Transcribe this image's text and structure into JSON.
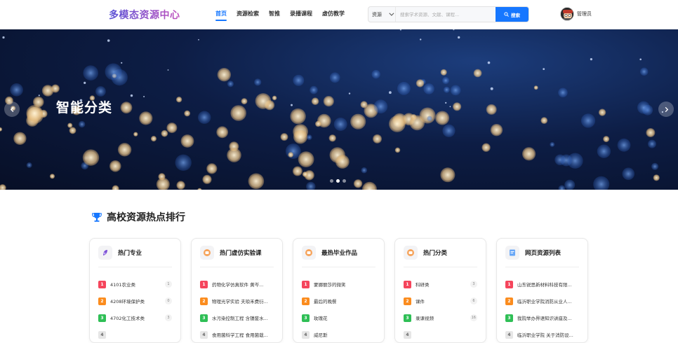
{
  "header": {
    "logo": "多模态资源中心",
    "nav": [
      {
        "label": "首页",
        "active": true
      },
      {
        "label": "资源检索",
        "active": false
      },
      {
        "label": "智推",
        "active": false
      },
      {
        "label": "录播课程",
        "active": false
      },
      {
        "label": "虚仿教学",
        "active": false
      }
    ],
    "search": {
      "type": "资源",
      "placeholder": "搜索学术资源、文献、课程...",
      "button": "搜索"
    },
    "user": {
      "name": "管理员"
    }
  },
  "banner": {
    "title": "智能分类",
    "slides": 3,
    "active_slide": 1
  },
  "section": {
    "title": "高校资源热点排行"
  },
  "cards": [
    {
      "title": "热门专业",
      "icon": "major-icon",
      "items": [
        {
          "rank": "1",
          "text": "4101农业类",
          "count": "1"
        },
        {
          "rank": "2",
          "text": "4208环境保护类",
          "count": "0"
        },
        {
          "rank": "3",
          "text": "4702化工技术类",
          "count": "3"
        },
        {
          "rank": "4",
          "text": "",
          "count": ""
        }
      ]
    },
    {
      "title": "热门虚仿实验课",
      "icon": "experiment-icon",
      "items": [
        {
          "rank": "1",
          "text": "药物化学仿真软件 黄岑...",
          "count": ""
        },
        {
          "rank": "2",
          "text": "物理光学实验 夫琅禾费衍...",
          "count": ""
        },
        {
          "rank": "3",
          "text": "水污染控制工程 含镍废水...",
          "count": ""
        },
        {
          "rank": "4",
          "text": "食用菌科学工程 食用菌栽...",
          "count": ""
        }
      ]
    },
    {
      "title": "最热毕业作品",
      "icon": "graduation-icon",
      "items": [
        {
          "rank": "1",
          "text": "蒙娜丽莎的微笑",
          "count": ""
        },
        {
          "rank": "2",
          "text": "最后的晚餐",
          "count": ""
        },
        {
          "rank": "3",
          "text": "玫瑰花",
          "count": ""
        },
        {
          "rank": "4",
          "text": "威尼斯",
          "count": ""
        }
      ]
    },
    {
      "title": "热门分类",
      "icon": "category-icon",
      "items": [
        {
          "rank": "1",
          "text": "科研类",
          "count": "3"
        },
        {
          "rank": "2",
          "text": "课件",
          "count": "6"
        },
        {
          "rank": "3",
          "text": "录课视频",
          "count": "16"
        },
        {
          "rank": "4",
          "text": "",
          "count": ""
        }
      ]
    },
    {
      "title": "网页资源列表",
      "icon": "web-resource-icon",
      "items": [
        {
          "rank": "1",
          "text": "山东锐思新材料科技有限...",
          "count": ""
        },
        {
          "rank": "2",
          "text": "临沂职业学院消防从业人...",
          "count": ""
        },
        {
          "rank": "3",
          "text": "我院举办界语知识讲座及...",
          "count": ""
        },
        {
          "rank": "4",
          "text": "临沂职业学院 关于消防设...",
          "count": ""
        }
      ]
    }
  ]
}
